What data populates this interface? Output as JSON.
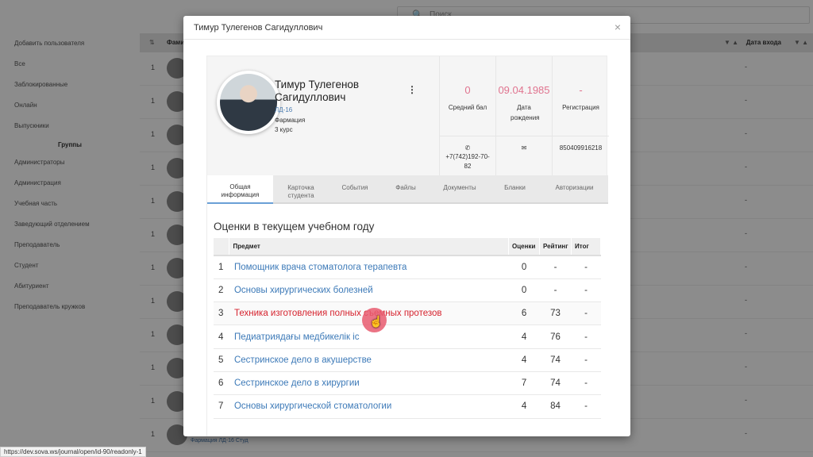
{
  "background": {
    "search_placeholder": "Поиск",
    "sidebar": {
      "items": [
        "Добавить пользователя",
        "Все",
        "Заблокированные",
        "Онлайн",
        "Выпускники"
      ],
      "heading": "Группы",
      "groups": [
        "Администраторы",
        "Администрация",
        "Учебная часть",
        "Заведующий отделением",
        "Преподаватель",
        "Студент",
        "Абитуриент",
        "Преподаватель кружков"
      ]
    },
    "table": {
      "col_name": "Фамилия",
      "col_last_login": "Дата входа",
      "sort_arrows": "▼ ▲",
      "row_dash": "-",
      "row_number": "1",
      "footer_text": "Фармация  ЛД-16  Студ"
    }
  },
  "modal": {
    "title": "Тимур Тулегенов Сагидуллович",
    "close_glyph": "×",
    "profile": {
      "name": "Тимур Тулегенов Сагидуллович",
      "group": "ЛД-16",
      "specialty": "Фармация",
      "course": "3 курс",
      "menu_glyph": "⋮"
    },
    "stats": [
      {
        "value": "0",
        "label": "Средний бал"
      },
      {
        "value": "09.04.1985",
        "label": "Дата рождения"
      },
      {
        "value": "-",
        "label": "Регистрация"
      }
    ],
    "contacts": {
      "phone_icon": "phone-icon",
      "phone": "+7(742)192-70-82",
      "email_icon": "envelope-icon",
      "iin": "850409916218"
    },
    "tabs": [
      "Общая информация",
      "Карточка студента",
      "События",
      "Файлы",
      "Документы",
      "Бланки",
      "Авторизации"
    ],
    "active_tab": 0,
    "section_title": "Оценки в текущем учебном году",
    "grades": {
      "headers": {
        "num": "",
        "subject": "Предмет",
        "grade": "Оценки",
        "rating": "Рейтинг",
        "total": "Итог"
      },
      "rows": [
        {
          "num": "1",
          "subject": "Помощник врача стоматолога терапевта",
          "grade": "0",
          "rating": "-",
          "total": "-"
        },
        {
          "num": "2",
          "subject": "Основы хирургических болезней",
          "grade": "0",
          "rating": "-",
          "total": "-"
        },
        {
          "num": "3",
          "subject": "Техника изготовления полных съемных протезов",
          "grade": "6",
          "rating": "73",
          "total": "-"
        },
        {
          "num": "4",
          "subject": "Педиатриядағы медбикелік іс",
          "grade": "4",
          "rating": "76",
          "total": "-"
        },
        {
          "num": "5",
          "subject": "Сестринское дело в акушерстве",
          "grade": "4",
          "rating": "74",
          "total": "-"
        },
        {
          "num": "6",
          "subject": "Сестринское дело в хирургии",
          "grade": "7",
          "rating": "74",
          "total": "-"
        },
        {
          "num": "7",
          "subject": "Основы хирургической стоматологии",
          "grade": "4",
          "rating": "84",
          "total": "-"
        }
      ]
    }
  },
  "status_bar": {
    "url": "https://dev.sova.ws/journal/open/id-90/readonly-1"
  },
  "colors": {
    "accent": "#3d7ab8",
    "stat_pink": "#e0748f",
    "link_hover": "#d6232e"
  }
}
